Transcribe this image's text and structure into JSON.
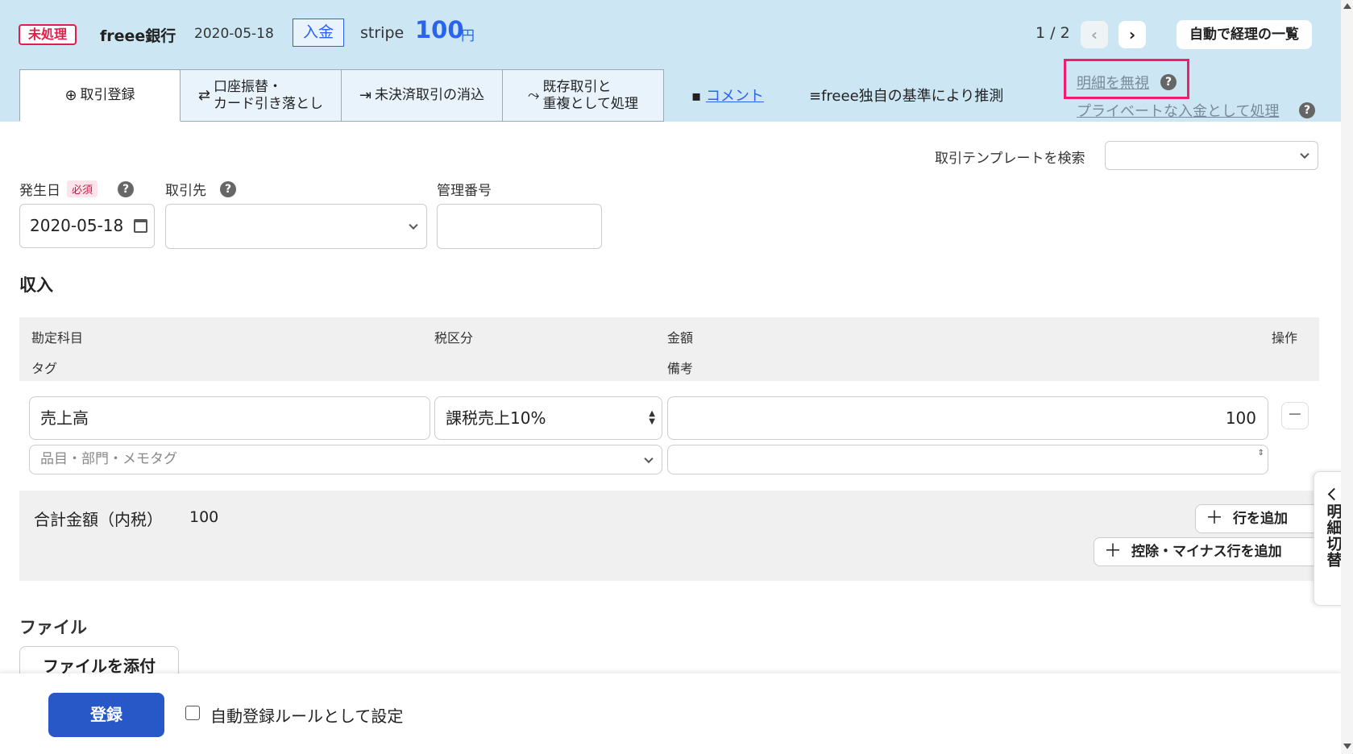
{
  "header": {
    "status": "未処理",
    "bank": "freee銀行",
    "date": "2020-05-18",
    "type_badge": "入金",
    "description": "stripe",
    "amount": "100",
    "amount_unit": "円",
    "pager": "1 / 2",
    "list_button": "自動で経理の一覧",
    "accent_color": "#2864f0",
    "background_color": "#cce6f4"
  },
  "tabs": [
    {
      "label": "取引登録",
      "icon": "plus-circle-icon",
      "active": true
    },
    {
      "label": "口座振替・カード引き落とし",
      "line1": "口座振替・",
      "line2": "カード引き落とし",
      "icon": "swap-arrows-icon"
    },
    {
      "label": "未決済取引の消込",
      "icon": "merge-icon"
    },
    {
      "label": "既存取引と重複として処理",
      "line1": "既存取引と",
      "line2": "重複として処理",
      "icon": "duplicate-icon"
    }
  ],
  "links": {
    "comment": "コメント",
    "guess": "freee独自の基準により推測",
    "ignore": "明細を無視",
    "private": "プライベートな入金として処理"
  },
  "form": {
    "template_search_label": "取引テンプレートを検索",
    "template_value": "",
    "date_label": "発生日",
    "required_badge": "必須",
    "date_value": "2020-05-18",
    "partner_label": "取引先",
    "partner_value": "",
    "mgmt_label": "管理番号",
    "mgmt_value": ""
  },
  "income": {
    "title": "収入",
    "headers": {
      "account": "勘定科目",
      "tax": "税区分",
      "amount": "金額",
      "action": "操作",
      "tag": "タグ",
      "memo": "備考"
    },
    "row": {
      "account": "売上高",
      "tax": "課税売上10%",
      "amount": "100",
      "tag_placeholder": "品目・部門・メモタグ",
      "memo": ""
    },
    "total_label": "合計金額（内税）",
    "total_value": "100",
    "add_row": "行を追加",
    "add_minus_row": "控除・マイナス行を追加"
  },
  "file": {
    "title": "ファイル",
    "attach_button": "ファイルを添付"
  },
  "side_toggle": "明細切替",
  "footer": {
    "submit": "登録",
    "auto_rule_label": "自動登録ルールとして設定",
    "auto_rule_checked": false
  }
}
